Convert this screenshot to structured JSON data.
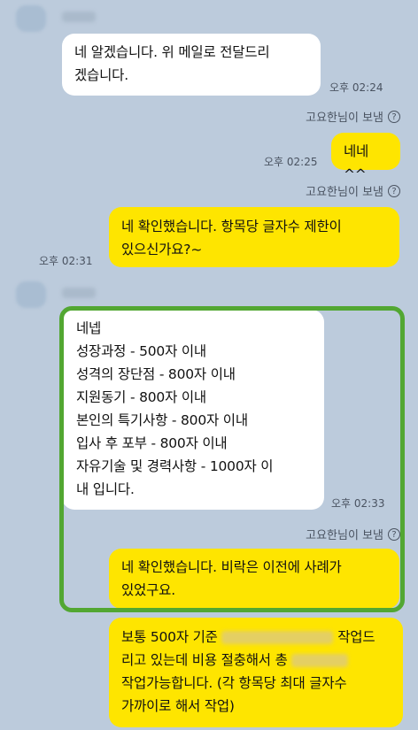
{
  "messages": [
    {
      "text": "네 알겠습니다. 위 메일로 전달드리\n겠습니다.",
      "time": "오후 02:24"
    },
    {
      "read_label": "고요한님이 보냄"
    },
    {
      "text": "네네^^",
      "time": "오후 02:25"
    },
    {
      "read_label": "고요한님이 보냄"
    },
    {
      "text": "네 확인했습니다. 항목당 글자수 제한이\n있으신가요?~",
      "time": "오후 02:31"
    },
    {
      "text": "네넵\n성장과정 - 500자 이내\n성격의 장단점 - 800자 이내\n지원동기 - 800자 이내\n본인의 특기사항 - 800자 이내\n입사 후 포부 - 800자 이내\n자유기술 및 경력사항 - 1000자 이\n내 입니다.",
      "time": "오후 02:33"
    },
    {
      "read_label": "고요한님이 보냄"
    },
    {
      "text": "네 확인했습니다. 비락은 이전에 사례가\n있었구요."
    },
    {
      "line1_a": "보통 500자 기준",
      "line1_b": "작업드",
      "line2_a": "리고 있는데 비용 절충해서 총",
      "line3": "작업가능합니다. (각 항목당 최대 글자수",
      "line4": "가까이로 해서 작업)"
    }
  ],
  "help_icon_glyph": "?",
  "colors": {
    "background": "#bccbdc",
    "incoming_bubble": "#ffffff",
    "outgoing_bubble": "#fee500",
    "highlight_border": "#52a732"
  }
}
